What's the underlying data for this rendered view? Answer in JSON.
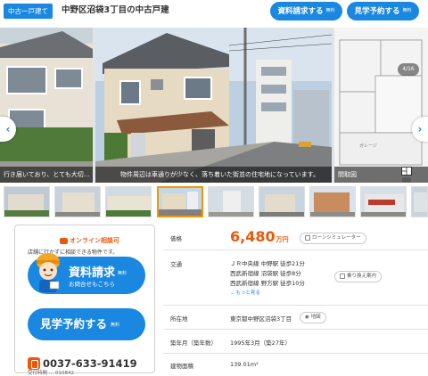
{
  "header": {
    "badge": "中古一戸建て",
    "title": "中野区沼袋3丁目の中古戸建",
    "doc_button": "資料請求する",
    "visit_button": "見学予約する",
    "free_tag": "無料"
  },
  "gallery": {
    "counter": "4/16",
    "captions": [
      "行き届いており、とても大切…",
      "物件周辺は車通りが少なく、落ち着いた街並の住宅地になっています。",
      "間取図"
    ],
    "floor_icon_label": "間取",
    "watermark": "※図面と異"
  },
  "contact": {
    "online_label": "オンライン相談可",
    "online_sub": "店舗に行かずに相談できる物件です。",
    "request_label": "資料請求",
    "request_free": "無料",
    "request_sub": "お問合せもこちら",
    "visit_label": "見学予約する",
    "visit_free": "無料",
    "phone": "0037-633-91419",
    "phone_sub": "受付時間 … 010842"
  },
  "details": {
    "price_label": "価格",
    "price_value": "6,480",
    "price_unit": "万円",
    "loan_chip": "ローンシミュレーター",
    "transport_label": "交通",
    "transport_lines": [
      "ＪＲ中央線 中野駅 徒歩21分",
      "西武新宿線 沼袋駅 徒歩8分",
      "西武新宿線 野方駅 徒歩10分"
    ],
    "route_chip": "乗り換え案内",
    "more_link": "もっと見る",
    "address_label": "所在地",
    "address_value": "東京都中野区沼袋3丁目",
    "map_chip": "地図",
    "built_label": "築年月（築年数）",
    "built_value": "1995年3月（築27年）",
    "area_label": "建物面積",
    "area_value": "139.01m²"
  },
  "colors": {
    "accent_blue": "#1a88e0",
    "price_orange": "#e8590c",
    "active_thumb": "#f39800"
  }
}
